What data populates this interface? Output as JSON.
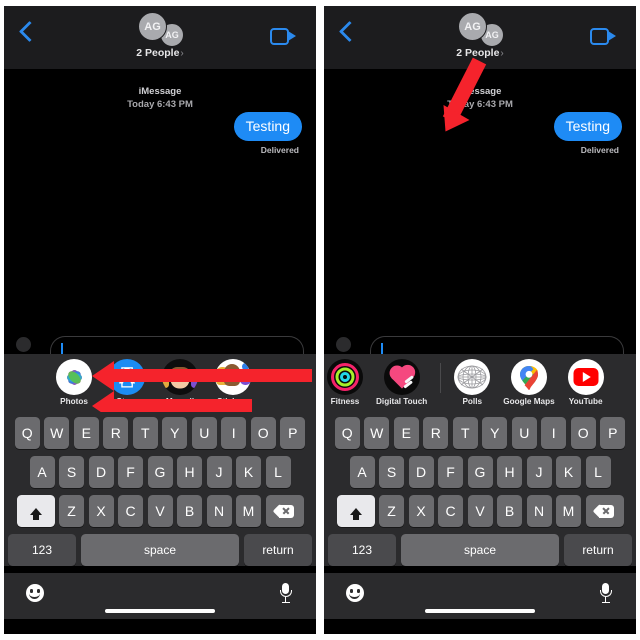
{
  "screenshot": {
    "type": "side-by-side-iphone-imessage-screenshots",
    "background_color": "#ffffff",
    "panel_count": 2
  },
  "navbar": {
    "back_icon": "chevron-left-icon",
    "facetime_icon": "video-camera-icon",
    "avatar_initials": [
      "AG",
      "AG"
    ],
    "participants_label": "2 People",
    "participants_chevron": "›",
    "accent_color": "#2b8aee"
  },
  "conversation": {
    "service_label": "iMessage",
    "timestamp": "Today 6:43 PM",
    "messages": [
      {
        "text": "Testing",
        "direction": "outgoing",
        "status": "Delivered",
        "bubble_color": "#1e8bf5"
      }
    ]
  },
  "left_panel": {
    "app_drawer": {
      "apps": [
        {
          "label": "Photos",
          "icon": "photos-icon"
        },
        {
          "label": "Store",
          "icon": "app-store-icon"
        },
        {
          "label": "Memoji",
          "icon": "memoji-icon"
        },
        {
          "label": "Stickers",
          "icon": "stickers-icon"
        }
      ]
    },
    "annotations": [
      {
        "type": "arrow",
        "direction": "left",
        "target": "Photos",
        "color": "#f5232c"
      },
      {
        "type": "arrow",
        "direction": "left",
        "target": "Photos",
        "color": "#f5232c"
      }
    ]
  },
  "right_panel": {
    "app_drawer": {
      "apps": [
        {
          "label": "Fitness",
          "icon": "fitness-rings-icon"
        },
        {
          "label": "Digital Touch",
          "icon": "digital-touch-heart-icon"
        },
        {
          "label": "Polls",
          "icon": "polls-icon"
        },
        {
          "label": "Google Maps",
          "icon": "google-maps-pin-icon"
        },
        {
          "label": "YouTube",
          "icon": "youtube-icon"
        }
      ]
    },
    "annotations": [
      {
        "type": "arrow",
        "direction": "down-left",
        "target": "Polls",
        "color": "#f5232c"
      }
    ]
  },
  "keyboard": {
    "row1": [
      "Q",
      "W",
      "E",
      "R",
      "T",
      "Y",
      "U",
      "I",
      "O",
      "P"
    ],
    "row2": [
      "A",
      "S",
      "D",
      "F",
      "G",
      "H",
      "J",
      "K",
      "L"
    ],
    "row3": [
      "Z",
      "X",
      "C",
      "V",
      "B",
      "N",
      "M"
    ],
    "shift_icon": "shift-up-arrow-icon",
    "delete_icon": "backspace-delete-icon",
    "numbers_key": "123",
    "space_key": "space",
    "return_key": "return",
    "emoji_icon": "emoji-smiley-icon",
    "dictation_icon": "microphone-icon",
    "home_indicator": "home-indicator-bar"
  },
  "compose": {
    "placeholder": "",
    "value": "",
    "plus_icon": "plus-apps-icon"
  }
}
